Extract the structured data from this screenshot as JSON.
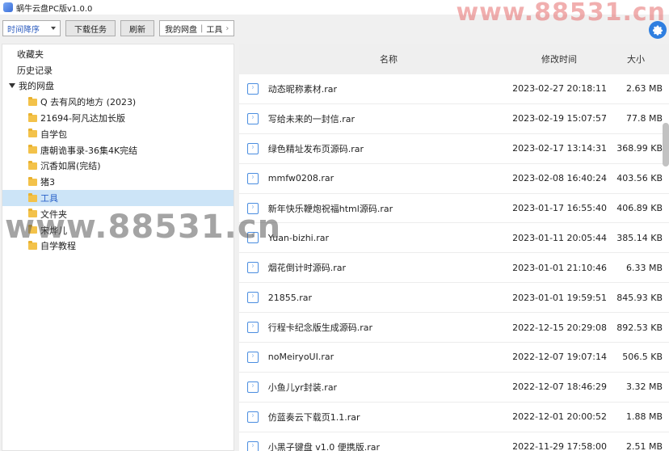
{
  "window": {
    "title": "蜗牛云盘PC版v1.0.0"
  },
  "watermark": {
    "top": "www.88531.cn",
    "middle": "www.88531.cn"
  },
  "toolbar": {
    "sort_select": "时间降序",
    "download_tasks": "下载任务",
    "refresh": "刷新",
    "breadcrumb": [
      "我的网盘",
      "工具"
    ]
  },
  "sidebar": {
    "favorites": "收藏夹",
    "history": "历史记录",
    "my_drive": "我的网盘",
    "folders": [
      {
        "label": "Q 去有风的地方 (2023)"
      },
      {
        "label": "21694-阿凡达加长版"
      },
      {
        "label": "自学包"
      },
      {
        "label": "唐朝诡事录-36集4K完结"
      },
      {
        "label": "沉香如屑(完结)"
      },
      {
        "label": "猪3"
      },
      {
        "label": "工具",
        "selected": true
      },
      {
        "label": "文件夹"
      },
      {
        "label": "宋烨儿"
      },
      {
        "label": "自学教程"
      }
    ]
  },
  "filelist": {
    "columns": {
      "name": "名称",
      "modified": "修改时间",
      "size": "大小"
    },
    "rows": [
      {
        "name": "动态昵称素材.rar",
        "modified": "2023-02-27 20:18:11",
        "size": "2.63 MB"
      },
      {
        "name": "写给未来的一封信.rar",
        "modified": "2023-02-19 15:07:57",
        "size": "77.8 MB"
      },
      {
        "name": "绿色精址发布页源码.rar",
        "modified": "2023-02-17 13:14:31",
        "size": "368.99 KB"
      },
      {
        "name": "mmfw0208.rar",
        "modified": "2023-02-08 16:40:24",
        "size": "403.56 KB"
      },
      {
        "name": "新年快乐鞭炮祝福html源码.rar",
        "modified": "2023-01-17 16:55:40",
        "size": "406.89 KB"
      },
      {
        "name": "Yuan-bizhi.rar",
        "modified": "2023-01-11 20:05:44",
        "size": "385.14 KB"
      },
      {
        "name": "烟花倒计时源码.rar",
        "modified": "2023-01-01 21:10:46",
        "size": "6.33 MB"
      },
      {
        "name": "21855.rar",
        "modified": "2023-01-01 19:59:51",
        "size": "845.93 KB"
      },
      {
        "name": "行程卡纪念版生成源码.rar",
        "modified": "2022-12-15 20:29:08",
        "size": "892.53 KB"
      },
      {
        "name": "noMeiryoUI.rar",
        "modified": "2022-12-07 19:07:14",
        "size": "506.5 KB"
      },
      {
        "name": "小鱼儿yr封装.rar",
        "modified": "2022-12-07 18:46:29",
        "size": "3.32 MB"
      },
      {
        "name": "仿蓝奏云下载页1.1.rar",
        "modified": "2022-12-01 20:00:52",
        "size": "1.88 MB"
      },
      {
        "name": "小黑子键盘 v1.0 便携版.rar",
        "modified": "2022-11-29 17:58:00",
        "size": "2.51 MB"
      }
    ]
  },
  "icons": {
    "app": "app-logo-icon",
    "settings": "gear-icon",
    "folder": "folder-icon",
    "file": "archive-file-icon",
    "expander": "chevron-down-icon"
  },
  "colors": {
    "accent": "#2f7fe0",
    "selected_bg": "#cce4f7",
    "folder": "#f3c24a"
  }
}
